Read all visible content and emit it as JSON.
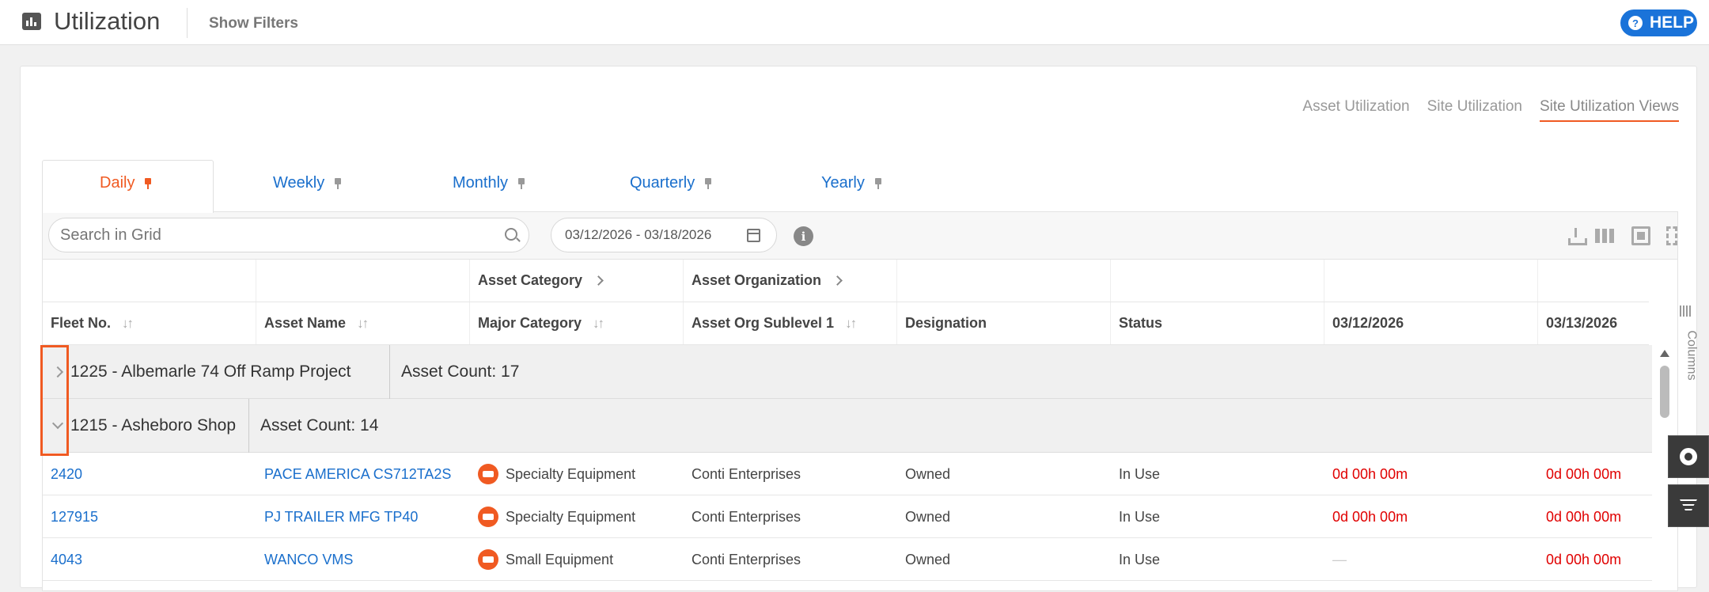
{
  "header": {
    "title": "Utilization",
    "show_filters": "Show Filters",
    "help": "HELP"
  },
  "view_links": [
    "Asset Utilization",
    "Site Utilization",
    "Site Utilization Views"
  ],
  "tabs": [
    "Daily",
    "Weekly",
    "Monthly",
    "Quarterly",
    "Yearly"
  ],
  "toolbar": {
    "search_placeholder": "Search in Grid",
    "date_range": "03/12/2026 - 03/18/2026"
  },
  "grid": {
    "group_headers": {
      "asset_category": "Asset Category",
      "asset_org": "Asset Organization"
    },
    "columns": [
      "Fleet No.",
      "Asset Name",
      "Major Category",
      "Asset Org Sublevel 1",
      "Designation",
      "Status",
      "03/12/2026",
      "03/13/2026"
    ],
    "columns_tab": "Columns",
    "groups": [
      {
        "title": "1225 - Albemarle 74 Off Ramp Project",
        "count": "Asset Count: 17",
        "expanded": false
      },
      {
        "title": "1215 - Asheboro Shop",
        "count": "Asset Count: 14",
        "expanded": true
      }
    ],
    "rows": [
      {
        "fleet": "2420",
        "name": "PACE AMERICA CS712TA2S",
        "category": "Specialty Equipment",
        "org": "Conti Enterprises",
        "designation": "Owned",
        "status": "In Use",
        "d1": "0d 00h 00m",
        "d2": "0d 00h 00m"
      },
      {
        "fleet": "127915",
        "name": "PJ TRAILER MFG TP40",
        "category": "Specialty Equipment",
        "org": "Conti Enterprises",
        "designation": "Owned",
        "status": "In Use",
        "d1": "0d 00h 00m",
        "d2": "0d 00h 00m"
      },
      {
        "fleet": "4043",
        "name": "WANCO VMS",
        "category": "Small Equipment",
        "org": "Conti Enterprises",
        "designation": "Owned",
        "status": "In Use",
        "d1": "—",
        "d2": "0d 00h 00m"
      }
    ]
  },
  "colors": {
    "accent": "#f05a22",
    "link": "#1a6fcc",
    "help": "#1a73d9",
    "negative": "#e00000"
  }
}
